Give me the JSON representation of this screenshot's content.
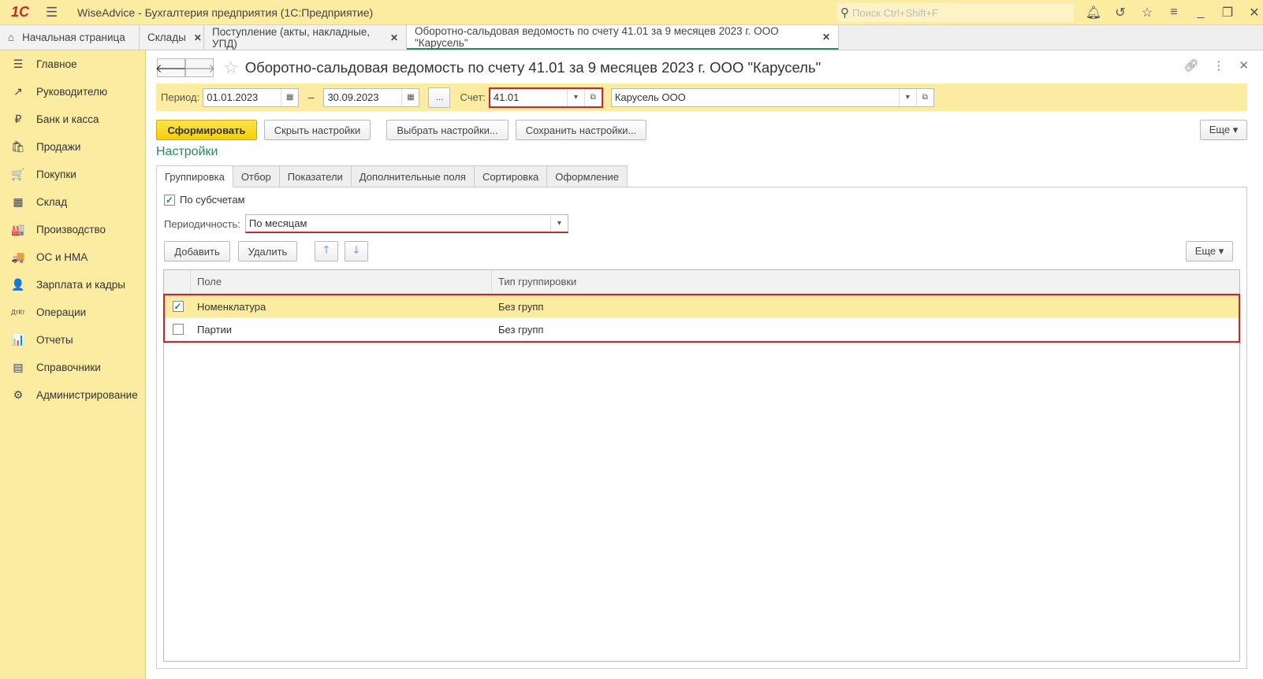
{
  "app": {
    "logo": "1С",
    "title": "WiseAdvice - Бухгалтерия предприятия  (1С:Предприятие)",
    "search_placeholder": "Поиск Ctrl+Shift+F"
  },
  "tabs": [
    {
      "label": "Начальная страница"
    },
    {
      "label": "Склады"
    },
    {
      "label": "Поступление (акты, накладные, УПД)"
    },
    {
      "label": "Оборотно-сальдовая ведомость по счету 41.01 за 9 месяцев 2023 г. ООО \"Карусель\""
    }
  ],
  "sidebar": {
    "items": [
      {
        "label": "Главное",
        "icon": "☰"
      },
      {
        "label": "Руководителю",
        "icon": "↗"
      },
      {
        "label": "Банк и касса",
        "icon": "₽"
      },
      {
        "label": "Продажи",
        "icon": "🛍"
      },
      {
        "label": "Покупки",
        "icon": "🛒"
      },
      {
        "label": "Склад",
        "icon": "▦"
      },
      {
        "label": "Производство",
        "icon": "🏭"
      },
      {
        "label": "ОС и НМА",
        "icon": "🚚"
      },
      {
        "label": "Зарплата и кадры",
        "icon": "👤"
      },
      {
        "label": "Операции",
        "icon": "ДтКт"
      },
      {
        "label": "Отчеты",
        "icon": "📊"
      },
      {
        "label": "Справочники",
        "icon": "▤"
      },
      {
        "label": "Администрирование",
        "icon": "⚙"
      }
    ]
  },
  "page": {
    "title": "Оборотно-сальдовая ведомость по счету 41.01 за 9 месяцев 2023 г. ООО \"Карусель\""
  },
  "filters": {
    "period_label": "Период:",
    "date_from": "01.01.2023",
    "dash": "–",
    "date_to": "30.09.2023",
    "ellipsis": "...",
    "account_label": "Счет:",
    "account": "41.01",
    "org": "Карусель ООО"
  },
  "toolbar": {
    "generate": "Сформировать",
    "hide_settings": "Скрыть настройки",
    "choose_settings": "Выбрать настройки...",
    "save_settings": "Сохранить настройки...",
    "more": "Еще ▾"
  },
  "settings": {
    "heading": "Настройки",
    "tabs": [
      "Группировка",
      "Отбор",
      "Показатели",
      "Дополнительные поля",
      "Сортировка",
      "Оформление"
    ],
    "by_subaccounts": "По субсчетам",
    "periodicity_label": "Периодичность:",
    "periodicity": "По месяцам",
    "add": "Добавить",
    "delete": "Удалить",
    "more": "Еще ▾",
    "columns": [
      "Поле",
      "Тип группировки"
    ],
    "rows": [
      {
        "field": "Номенклатура",
        "type": "Без групп",
        "checked": true
      },
      {
        "field": "Партии",
        "type": "Без групп",
        "checked": false
      }
    ]
  }
}
